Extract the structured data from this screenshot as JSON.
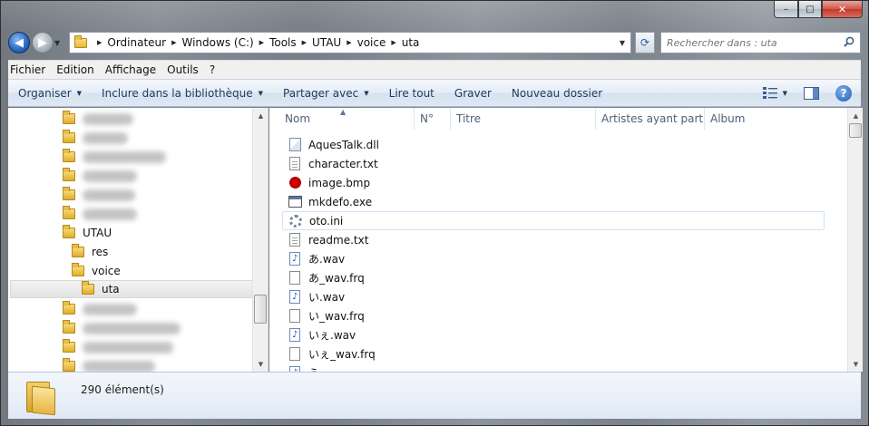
{
  "window": {
    "controls": {
      "minimize": "–",
      "maximize": "□",
      "close": "✕"
    }
  },
  "nav": {
    "back_icon": "◀",
    "forward_icon": "▶",
    "refresh_icon": "⟳",
    "breadcrumbs": [
      "Ordinateur",
      "Windows (C:)",
      "Tools",
      "UTAU",
      "voice",
      "uta"
    ],
    "search_placeholder": "Rechercher dans : uta"
  },
  "menubar": {
    "items": [
      "Fichier",
      "Edition",
      "Affichage",
      "Outils",
      "?"
    ]
  },
  "commandbar": {
    "organize": "Organiser",
    "include": "Inclure dans la bibliothèque",
    "share": "Partager avec",
    "play_all": "Lire tout",
    "burn": "Graver",
    "new_folder": "Nouveau dossier",
    "help": "?"
  },
  "tree": {
    "utau": "UTAU",
    "res": "res",
    "voice": "voice",
    "uta": "uta"
  },
  "columns": [
    "Nom",
    "N°",
    "Titre",
    "Artistes ayant parti...",
    "Album"
  ],
  "files": [
    {
      "name": "AquesTalk.dll",
      "icon": "dll-icon"
    },
    {
      "name": "character.txt",
      "icon": "text-file-icon"
    },
    {
      "name": "image.bmp",
      "icon": "bitmap-icon"
    },
    {
      "name": "mkdefo.exe",
      "icon": "exe-icon"
    },
    {
      "name": "oto.ini",
      "icon": "settings-file-icon"
    },
    {
      "name": "readme.txt",
      "icon": "text-file-icon"
    },
    {
      "name": "あ.wav",
      "icon": "audio-file-icon"
    },
    {
      "name": "あ_wav.frq",
      "icon": "blank-file-icon"
    },
    {
      "name": "い.wav",
      "icon": "audio-file-icon"
    },
    {
      "name": "い_wav.frq",
      "icon": "blank-file-icon"
    },
    {
      "name": "いぇ.wav",
      "icon": "audio-file-icon"
    },
    {
      "name": "いぇ_wav.frq",
      "icon": "blank-file-icon"
    },
    {
      "name": "う",
      "icon": "audio-file-icon"
    }
  ],
  "status": {
    "count": "290 élément(s)"
  },
  "colors": {
    "selection_border": "#cfe2f5",
    "command_text": "#1e395b",
    "header_text": "#4c607a"
  }
}
